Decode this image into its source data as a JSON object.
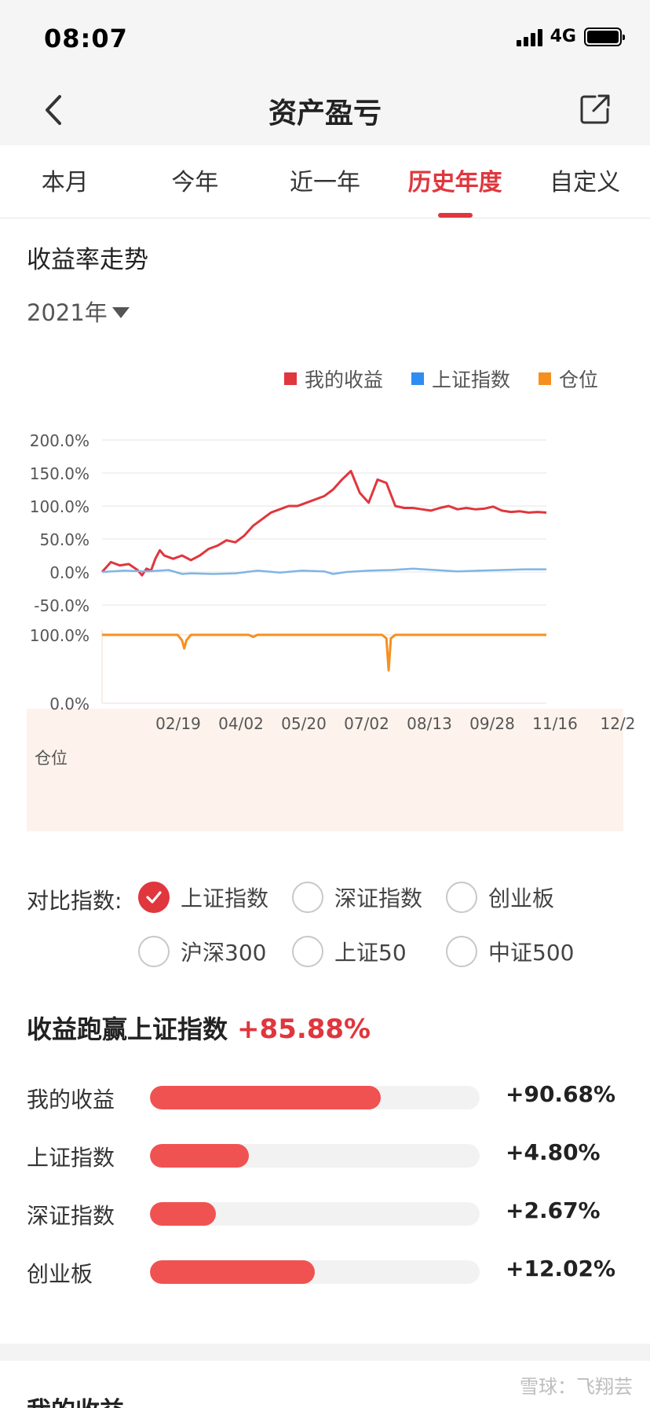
{
  "status_bar": {
    "time": "08:07",
    "network": "4G"
  },
  "nav": {
    "title": "资产盈亏",
    "back_icon": "chevron-left-icon",
    "share_icon": "share-icon"
  },
  "tabs": [
    {
      "label": "本月",
      "active": false
    },
    {
      "label": "今年",
      "active": false
    },
    {
      "label": "近一年",
      "active": false
    },
    {
      "label": "历史年度",
      "active": true
    },
    {
      "label": "自定义",
      "active": false
    }
  ],
  "trend": {
    "title": "收益率走势",
    "year": "2021年"
  },
  "legend": [
    {
      "label": "我的收益",
      "color": "#e0363d"
    },
    {
      "label": "上证指数",
      "color": "#2f8cf0"
    },
    {
      "label": "仓位",
      "color": "#f59020"
    }
  ],
  "chart_data": [
    {
      "type": "line",
      "title": "",
      "y_ticks": [
        "200.0%",
        "150.0%",
        "100.0%",
        "50.0%",
        "0.0%",
        "-50.0%"
      ],
      "ylim": [
        -50,
        200
      ],
      "x_ticks": [
        "02/19",
        "04/02",
        "05/20",
        "07/02",
        "08/13",
        "09/28",
        "11/16",
        "12/2"
      ],
      "x_range": [
        0,
        100
      ],
      "grid": true,
      "legend_position": "top-right",
      "series": [
        {
          "name": "我的收益",
          "color": "#e0363d",
          "x": [
            0,
            2,
            4,
            6,
            8,
            9,
            10,
            11,
            12,
            13,
            14,
            16,
            18,
            20,
            22,
            24,
            26,
            28,
            30,
            32,
            34,
            36,
            38,
            40,
            42,
            44,
            46,
            48,
            50,
            52,
            54,
            56,
            58,
            60,
            62,
            64,
            66,
            68,
            70,
            72,
            74,
            76,
            78,
            80,
            82,
            84,
            86,
            88,
            90,
            92,
            94,
            96,
            98,
            100
          ],
          "values": [
            0,
            15,
            10,
            12,
            3,
            -5,
            5,
            2,
            20,
            33,
            25,
            20,
            25,
            18,
            25,
            35,
            40,
            48,
            45,
            55,
            70,
            80,
            90,
            95,
            100,
            100,
            105,
            110,
            115,
            125,
            140,
            153,
            120,
            105,
            140,
            135,
            100,
            97,
            97,
            95,
            93,
            97,
            100,
            95,
            97,
            95,
            96,
            99,
            93,
            91,
            92,
            90,
            91,
            90
          ]
        },
        {
          "name": "上证指数",
          "color": "#7fb5e6",
          "x": [
            0,
            5,
            10,
            15,
            18,
            20,
            25,
            30,
            35,
            40,
            45,
            50,
            52,
            55,
            60,
            65,
            70,
            75,
            80,
            85,
            90,
            95,
            100
          ],
          "values": [
            0,
            2,
            1,
            3,
            -3,
            -2,
            -3,
            -2,
            2,
            -1,
            2,
            1,
            -3,
            0,
            2,
            3,
            5,
            3,
            1,
            2,
            3,
            4,
            4
          ]
        }
      ]
    },
    {
      "type": "line",
      "title": "",
      "ylabel": "仓位",
      "y_ticks": [
        "100.0%",
        "0.0%"
      ],
      "ylim": [
        0,
        100
      ],
      "series": [
        {
          "name": "仓位",
          "color": "#f59020",
          "x": [
            0,
            17,
            18,
            18.5,
            19,
            20,
            33,
            34,
            35,
            63,
            64,
            64.5,
            65,
            66,
            100
          ],
          "values": [
            100,
            100,
            92,
            80,
            92,
            100,
            100,
            97,
            100,
            100,
            95,
            48,
            95,
            100,
            100
          ]
        }
      ]
    }
  ],
  "compare": {
    "label": "对比指数:",
    "options": [
      {
        "label": "上证指数",
        "checked": true
      },
      {
        "label": "深证指数",
        "checked": false
      },
      {
        "label": "创业板",
        "checked": false
      },
      {
        "label": "沪深300",
        "checked": false
      },
      {
        "label": "上证50",
        "checked": false
      },
      {
        "label": "中证500",
        "checked": false
      }
    ]
  },
  "beat": {
    "label": "收益跑赢上证指数",
    "value": "+85.88%"
  },
  "bars": [
    {
      "label": "我的收益",
      "value": "+90.68%",
      "fraction": 0.7
    },
    {
      "label": "上证指数",
      "value": "+4.80%",
      "fraction": 0.3
    },
    {
      "label": "深证指数",
      "value": "+2.67%",
      "fraction": 0.2
    },
    {
      "label": "创业板",
      "value": "+12.02%",
      "fraction": 0.5
    }
  ],
  "next_section": {
    "title": "我的收益"
  },
  "watermark": "雪球：飞翔芸"
}
